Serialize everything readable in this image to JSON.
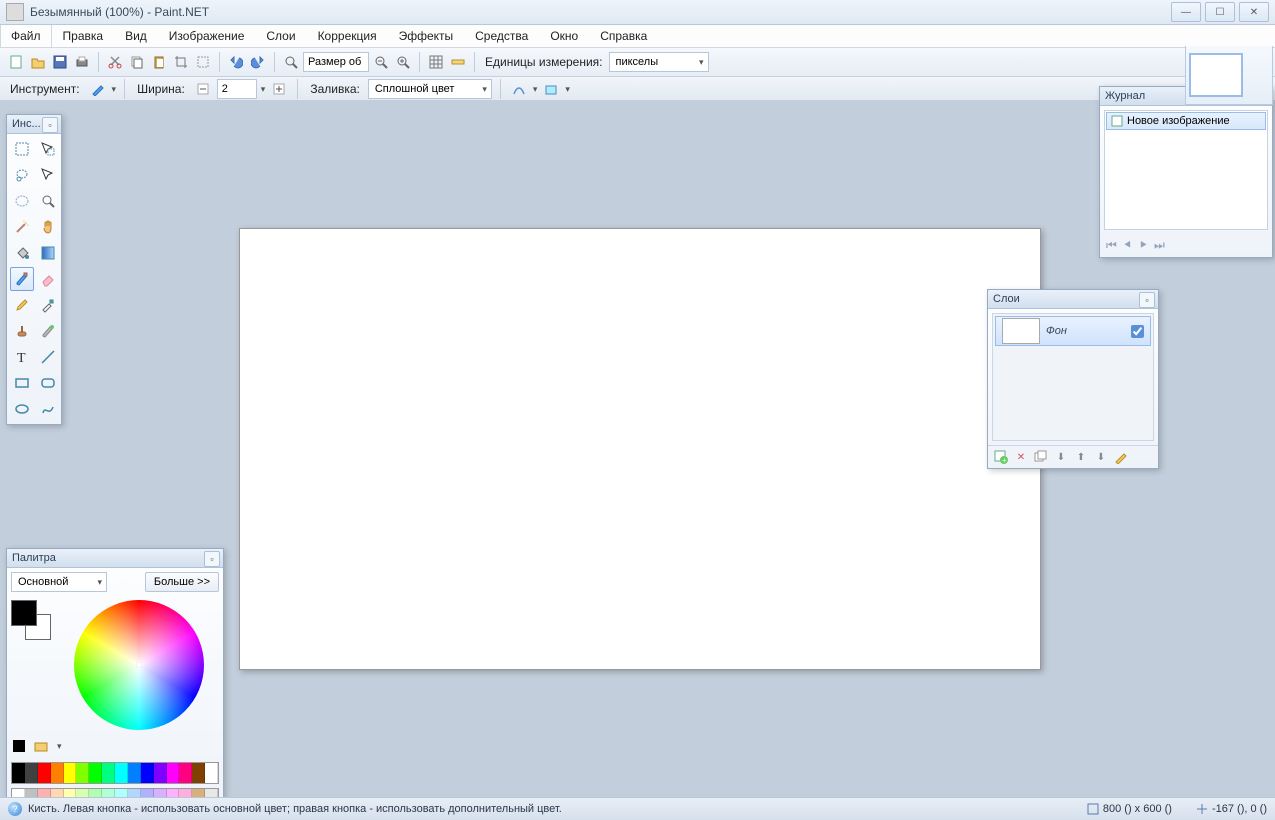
{
  "title": "Безымянный (100%) - Paint.NET",
  "menu": [
    "Файл",
    "Правка",
    "Вид",
    "Изображение",
    "Слои",
    "Коррекция",
    "Эффекты",
    "Средства",
    "Окно",
    "Справка"
  ],
  "toolbar": {
    "size_label": "Размер об",
    "units_label": "Единицы измерения:",
    "units_value": "пикселы"
  },
  "optbar": {
    "tool_label": "Инструмент:",
    "width_label": "Ширина:",
    "width_value": "2",
    "fill_label": "Заливка:",
    "fill_value": "Сплошной цвет"
  },
  "panels": {
    "tools_title": "Инс...",
    "history_title": "Журнал",
    "history_item": "Новое изображение",
    "layers_title": "Слои",
    "layer_name": "Фон",
    "palette_title": "Палитра",
    "palette_mode": "Основной",
    "palette_more": "Больше >>"
  },
  "status": {
    "text": "Кисть. Левая кнопка - использовать основной цвет; правая кнопка - использовать дополнительный цвет.",
    "dims": "800 () x 600 ()",
    "coords": "-167 (), 0 ()"
  },
  "swatches": [
    "#000",
    "#404040",
    "#ff0000",
    "#ff8000",
    "#ffff00",
    "#80ff00",
    "#00ff00",
    "#00ff80",
    "#00ffff",
    "#0080ff",
    "#0000ff",
    "#8000ff",
    "#ff00ff",
    "#ff0080",
    "#804000",
    "#ffffff"
  ]
}
